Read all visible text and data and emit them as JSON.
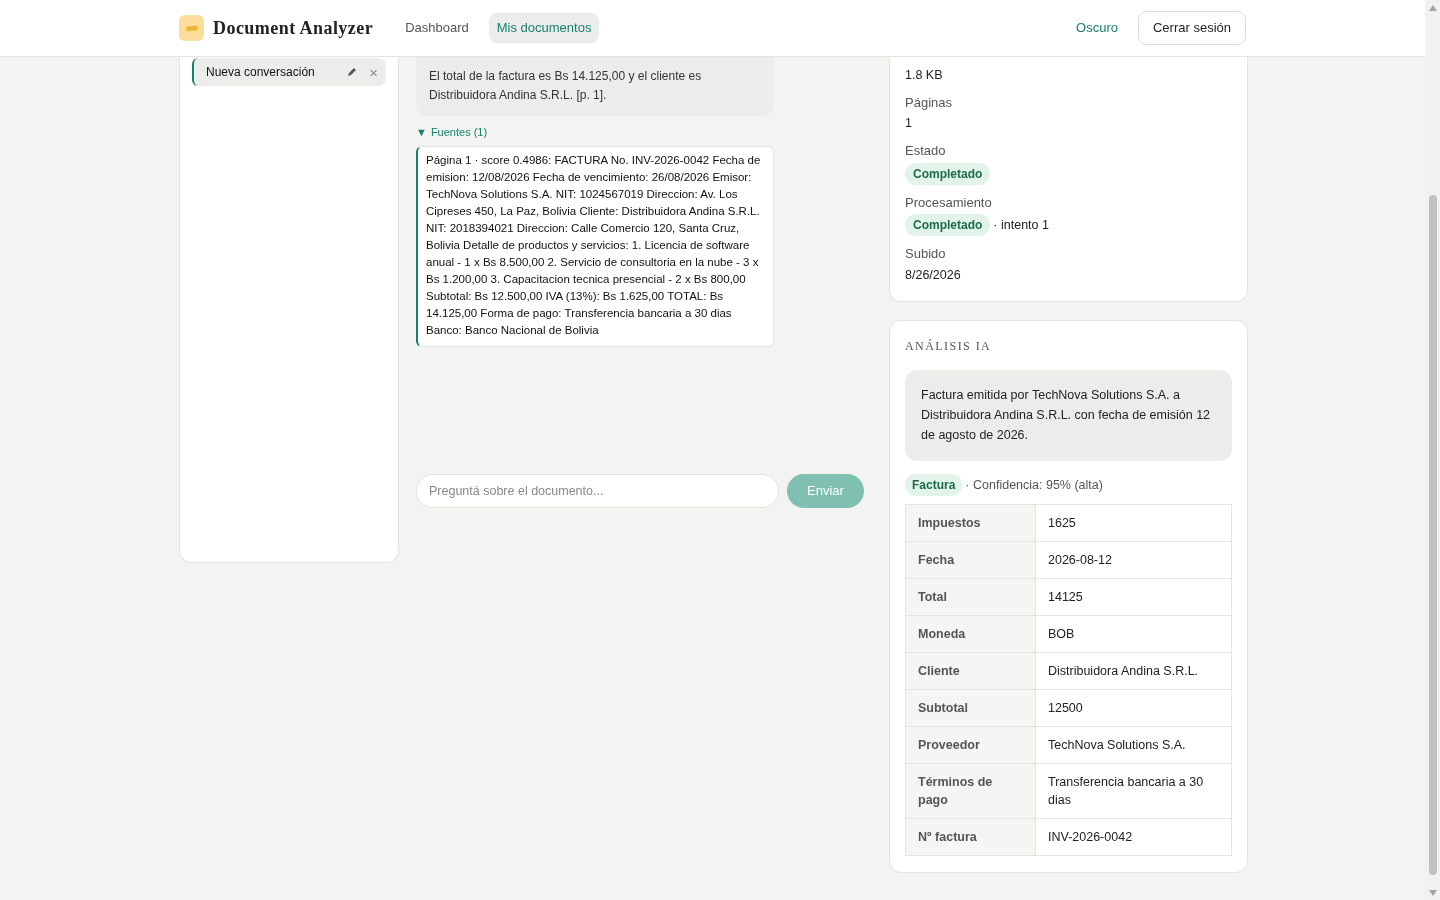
{
  "header": {
    "brand": "Document Analyzer",
    "nav": [
      {
        "label": "Dashboard",
        "selected": false
      },
      {
        "label": "Mis documentos",
        "selected": true
      }
    ],
    "theme_toggle": "Oscuro",
    "logout": "Cerrar sesión"
  },
  "conversations": [
    {
      "title": "Nueva conversación",
      "selected": true,
      "close": "×"
    }
  ],
  "chat": {
    "messages": [
      {
        "text": "El total de la factura es Bs 14.125,00 y el cliente es Distribuidora Andina S.R.L. [p. 1]."
      }
    ],
    "sources": {
      "toggle": "▼",
      "label": "Fuentes (1)",
      "expanded": true,
      "items": [
        "Página 1 · score 0.4986: FACTURA No. INV-2026-0042 Fecha de emision: 12/08/2026 Fecha de vencimiento: 26/08/2026 Emisor: TechNova Solutions S.A. NIT: 1024567019 Direccion: Av. Los Cipreses 450, La Paz, Bolivia Cliente: Distribuidora Andina S.R.L. NIT: 2018394021 Direccion: Calle Comercio 120, Santa Cruz, Bolivia Detalle de productos y servicios: 1. Licencia de software anual - 1 x Bs 8.500,00 2. Servicio de consultoria en la nube - 3 x Bs 1.200,00 3. Capacitacion tecnica presencial - 2 x Bs 800,00 Subtotal: Bs 12.500,00 IVA (13%): Bs 1.625,00 TOTAL: Bs 14.125,00 Forma de pago: Transferencia bancaria a 30 dias Banco: Banco Nacional de Bolivia"
      ]
    },
    "input": {
      "placeholder": "Preguntá sobre el documento..."
    },
    "send": {
      "label": "Enviar",
      "disabled": true
    }
  },
  "details": [
    {
      "kind": "text",
      "value": "1.8 KB"
    },
    {
      "kind": "field",
      "label": "Páginas",
      "value": "1"
    },
    {
      "kind": "badge",
      "label": "Estado",
      "badge": "Completado"
    },
    {
      "kind": "badge",
      "label": "Procesamiento",
      "badge": "Completado",
      "note": "· intento 1"
    },
    {
      "kind": "field",
      "label": "Subido",
      "value": "8/26/2026"
    }
  ],
  "analysis": {
    "title": "ANÁLISIS IA",
    "summary": "Factura emitida por TechNova Solutions S.A. a Distribuidora Andina S.R.L. con fecha de emisión 12 de agosto de 2026.",
    "type_badge": "Factura",
    "confidence": "· Confidencia: 95% (alta)",
    "fields": [
      {
        "label": "Impuestos",
        "value": "1625"
      },
      {
        "label": "Fecha",
        "value": "2026-08-12"
      },
      {
        "label": "Total",
        "value": "14125"
      },
      {
        "label": "Moneda",
        "value": "BOB"
      },
      {
        "label": "Cliente",
        "value": "Distribuidora Andina S.R.L."
      },
      {
        "label": "Subtotal",
        "value": "12500"
      },
      {
        "label": "Proveedor",
        "value": "TechNova Solutions S.A."
      },
      {
        "label": "Términos de pago",
        "value": "Transferencia bancaria a 30 dias"
      },
      {
        "label": "Nº factura",
        "value": "INV-2026-0042"
      }
    ]
  }
}
